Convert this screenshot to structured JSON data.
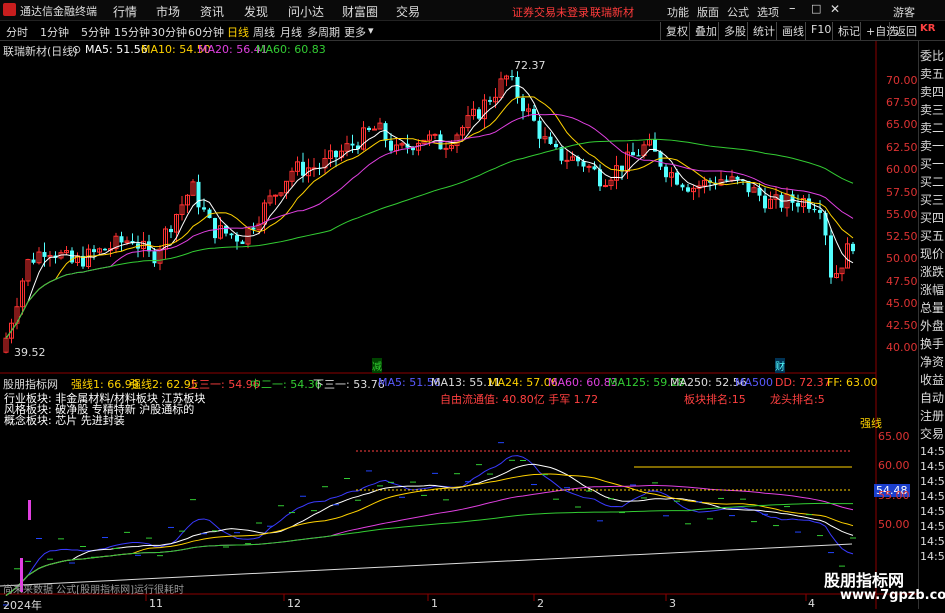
{
  "window": {
    "app_title": "通达信金融终端",
    "menu": [
      "行情",
      "市场",
      "资讯",
      "发现",
      "问小达",
      "财富圈",
      "交易"
    ],
    "notice": "证券交易未登录",
    "stock_title": "联瑞新材",
    "right_menu": [
      "功能",
      "版面",
      "公式",
      "选项"
    ],
    "user": "游客"
  },
  "toolbar": {
    "periods": [
      "分时",
      "1分钟",
      "5分钟",
      "15分钟",
      "30分钟",
      "60分钟",
      "日线",
      "周线",
      "月线",
      "多周期",
      "更多"
    ],
    "active_period": "日线",
    "right_buttons": [
      "复权",
      "叠加",
      "多股",
      "统计",
      "画线",
      "F10",
      "标记",
      "+自选",
      "返回"
    ]
  },
  "main_chart": {
    "name": "联瑞新材(日线)",
    "ma5": "MA5: 51.56",
    "ma10": "MA10: 54.50",
    "ma20": "MA20: 56.41",
    "ma60": "MA60: 60.83",
    "high_label": "72.37",
    "low_label": "39.52",
    "event_markers": [
      "减",
      "财"
    ],
    "price_axis": [
      "70.00",
      "67.50",
      "65.00",
      "62.50",
      "60.00",
      "57.50",
      "55.00",
      "52.50",
      "50.00",
      "47.50",
      "45.00",
      "42.50",
      "40.00"
    ],
    "colors": {
      "up": "#ff3232",
      "down": "#54ffff",
      "ma5": "#ffffff",
      "ma10": "#ffd200",
      "ma20": "#e040e0",
      "ma60": "#33cc33"
    }
  },
  "right_panel": {
    "items": [
      "委比",
      "卖五",
      "卖四",
      "卖三",
      "卖二",
      "卖一",
      "买一",
      "买二",
      "买三",
      "买四",
      "买五",
      "现价",
      "涨跌",
      "涨幅",
      "总量",
      "外盘",
      "换手",
      "净资",
      "收益",
      "自动",
      "注册",
      "交易"
    ],
    "times": [
      "14:5",
      "14:5",
      "14:5",
      "14:5",
      "14:5",
      "14:5",
      "14:5",
      "14:5"
    ],
    "kr": "KR"
  },
  "indicator": {
    "name": "股朋指标网",
    "strong1": "强线1: 66.99",
    "strong2": "强线2: 62.95",
    "upper": "上三一: 54.96",
    "mid": "中二一: 54.36",
    "lower": "下三一: 53.76",
    "ma5": "MA5: 51.56",
    "ma13": "MA13: 55.11",
    "ma24": "MA24: 57.06",
    "ma60": "MA60: 60.83",
    "ma125": "MA125: 59.28",
    "ma250": "MA250: 52.56",
    "ma500": "MA500",
    "dd": "DD: 72.37",
    "ff": "FF: 63.00",
    "sector_lines": [
      "行业板块: 非金属材料/材料板块 江苏板块",
      "风格板块: 破净股 专精特新 沪股通标的",
      "概念板块: 芯片 先进封装"
    ],
    "free_float": "自由流通值: 40.80亿 手军 1.72",
    "sector_rank": "板块排名:15",
    "leader_rank": "龙头排名:5",
    "strong_tag": "强线",
    "value_box": "54.48",
    "status": "尚未来数据  公式[股朋指标网]运行很耗时",
    "axis": [
      "65.00",
      "60.00",
      "55.00",
      "50.00"
    ]
  },
  "date_axis": [
    "2024年",
    "11",
    "12",
    "1",
    "2",
    "3",
    "4"
  ],
  "watermark": {
    "line1": "股朋指标网",
    "line2": "www.7gpzb.com"
  }
}
